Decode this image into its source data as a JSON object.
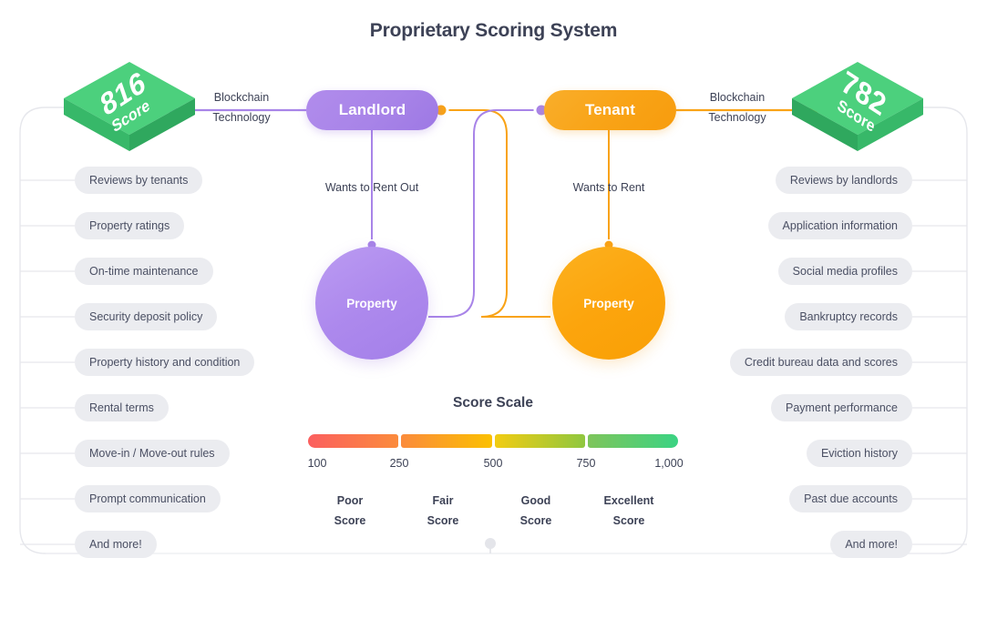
{
  "title": "Proprietary Scoring System",
  "colors": {
    "purple": "#a884e8",
    "orange": "#f9a316",
    "green": "#4cd07d",
    "text_dark": "#3d4256",
    "pill_bg": "#ebecf0",
    "line_gray": "#e4e5ea"
  },
  "left": {
    "score": "816",
    "score_label": "Score",
    "blockchain_line1": "Blockchain",
    "blockchain_line2": "Technology",
    "role": "Landlord",
    "wants": "Wants to Rent Out",
    "property": "Property",
    "attributes": [
      "Reviews by tenants",
      "Property ratings",
      "On-time maintenance",
      "Security deposit policy",
      "Property history and condition",
      "Rental terms",
      "Move-in / Move-out rules",
      "Prompt communication",
      "And more!"
    ]
  },
  "right": {
    "score": "782",
    "score_label": "Score",
    "blockchain_line1": "Blockchain",
    "blockchain_line2": "Technology",
    "role": "Tenant",
    "wants": "Wants to Rent",
    "property": "Property",
    "attributes": [
      "Reviews by landlords",
      "Application information",
      "Social media profiles",
      "Bankruptcy records",
      "Credit bureau data and scores",
      "Payment performance",
      "Eviction history",
      "Past due accounts",
      "And more!"
    ]
  },
  "chart_data": {
    "type": "bar",
    "title": "Score Scale",
    "xlabel": "",
    "ylabel": "",
    "categories": [
      "Poor Score",
      "Fair Score",
      "Good Score",
      "Excellent Score"
    ],
    "values": [
      250,
      250,
      250,
      250
    ],
    "tick_labels": [
      "100",
      "250",
      "500",
      "750",
      "1,000"
    ],
    "tick_values": [
      100,
      250,
      500,
      750,
      1000
    ],
    "xlim": [
      100,
      1000
    ],
    "grid": false,
    "legend": "none",
    "segments": [
      {
        "label": "Poor Score",
        "range": [
          100,
          250
        ],
        "color_start": "#fb5f5f",
        "color_end": "#fb8b3c"
      },
      {
        "label": "Fair Score",
        "range": [
          250,
          500
        ],
        "color_start": "#fb8b3c",
        "color_end": "#fbc000"
      },
      {
        "label": "Good Score",
        "range": [
          500,
          750
        ],
        "color_start": "#f2cc12",
        "color_end": "#8fc73f"
      },
      {
        "label": "Excellent Score",
        "range": [
          750,
          1000
        ],
        "color_start": "#7ec55b",
        "color_end": "#3ad383"
      }
    ]
  },
  "scale": {
    "ratings": [
      {
        "name": "Poor",
        "word": "Score"
      },
      {
        "name": "Fair",
        "word": "Score"
      },
      {
        "name": "Good",
        "word": "Score"
      },
      {
        "name": "Excellent",
        "word": "Score"
      }
    ]
  }
}
